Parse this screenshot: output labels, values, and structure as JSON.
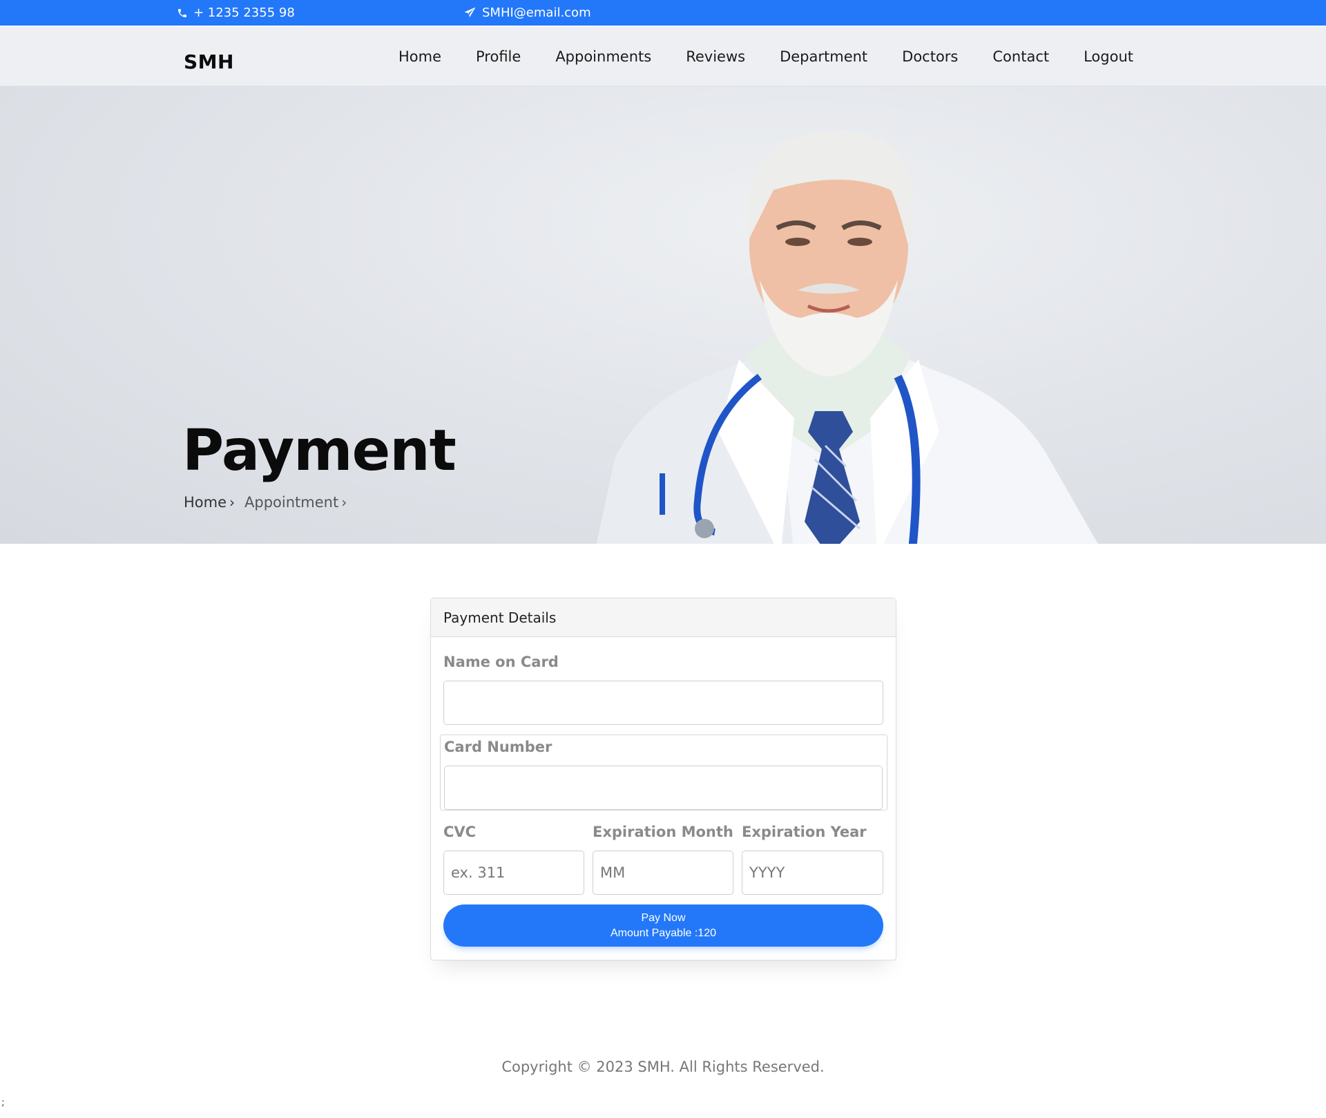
{
  "topbar": {
    "phone": "+ 1235 2355 98",
    "phone_icon": "phone-icon",
    "email": "SMHI@email.com",
    "email_icon": "paper-plane-icon"
  },
  "header": {
    "logo": "SMH",
    "nav": [
      "Home",
      "Profile",
      "Appoinments",
      "Reviews",
      "Department",
      "Doctors",
      "Contact",
      "Logout"
    ]
  },
  "hero": {
    "title": "Payment",
    "breadcrumb": [
      "Home",
      "Appointment"
    ],
    "image": "doctor-photo"
  },
  "payment": {
    "header": "Payment Details",
    "name_label": "Name on Card",
    "name_value": "",
    "card_label": "Card Number",
    "card_value": "",
    "cvc_label": "CVC",
    "cvc_placeholder": "ex. 311",
    "month_label": "Expiration Month",
    "month_placeholder": "MM",
    "year_label": "Expiration Year",
    "year_placeholder": "YYYY",
    "button_line1": "Pay Now",
    "button_line2": "Amount Payable :120"
  },
  "footer": {
    "copyright": "Copyright © 2023 SMH. All Rights Reserved."
  },
  "stray_text": ";",
  "colors": {
    "primary": "#2378f9",
    "label_gray": "#8a8a8a"
  }
}
